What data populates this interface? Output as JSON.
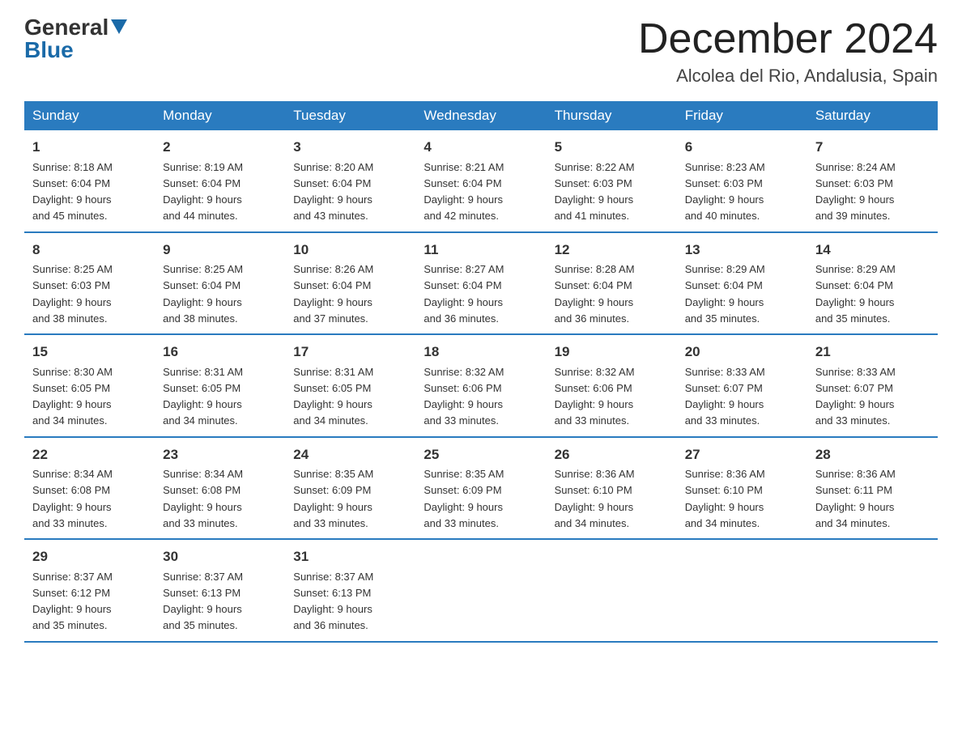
{
  "header": {
    "logo_general": "General",
    "logo_blue": "Blue",
    "month_title": "December 2024",
    "location": "Alcolea del Rio, Andalusia, Spain"
  },
  "days_of_week": [
    "Sunday",
    "Monday",
    "Tuesday",
    "Wednesday",
    "Thursday",
    "Friday",
    "Saturday"
  ],
  "weeks": [
    [
      {
        "day": "1",
        "sunrise": "8:18 AM",
        "sunset": "6:04 PM",
        "daylight": "9 hours and 45 minutes."
      },
      {
        "day": "2",
        "sunrise": "8:19 AM",
        "sunset": "6:04 PM",
        "daylight": "9 hours and 44 minutes."
      },
      {
        "day": "3",
        "sunrise": "8:20 AM",
        "sunset": "6:04 PM",
        "daylight": "9 hours and 43 minutes."
      },
      {
        "day": "4",
        "sunrise": "8:21 AM",
        "sunset": "6:04 PM",
        "daylight": "9 hours and 42 minutes."
      },
      {
        "day": "5",
        "sunrise": "8:22 AM",
        "sunset": "6:03 PM",
        "daylight": "9 hours and 41 minutes."
      },
      {
        "day": "6",
        "sunrise": "8:23 AM",
        "sunset": "6:03 PM",
        "daylight": "9 hours and 40 minutes."
      },
      {
        "day": "7",
        "sunrise": "8:24 AM",
        "sunset": "6:03 PM",
        "daylight": "9 hours and 39 minutes."
      }
    ],
    [
      {
        "day": "8",
        "sunrise": "8:25 AM",
        "sunset": "6:03 PM",
        "daylight": "9 hours and 38 minutes."
      },
      {
        "day": "9",
        "sunrise": "8:25 AM",
        "sunset": "6:04 PM",
        "daylight": "9 hours and 38 minutes."
      },
      {
        "day": "10",
        "sunrise": "8:26 AM",
        "sunset": "6:04 PM",
        "daylight": "9 hours and 37 minutes."
      },
      {
        "day": "11",
        "sunrise": "8:27 AM",
        "sunset": "6:04 PM",
        "daylight": "9 hours and 36 minutes."
      },
      {
        "day": "12",
        "sunrise": "8:28 AM",
        "sunset": "6:04 PM",
        "daylight": "9 hours and 36 minutes."
      },
      {
        "day": "13",
        "sunrise": "8:29 AM",
        "sunset": "6:04 PM",
        "daylight": "9 hours and 35 minutes."
      },
      {
        "day": "14",
        "sunrise": "8:29 AM",
        "sunset": "6:04 PM",
        "daylight": "9 hours and 35 minutes."
      }
    ],
    [
      {
        "day": "15",
        "sunrise": "8:30 AM",
        "sunset": "6:05 PM",
        "daylight": "9 hours and 34 minutes."
      },
      {
        "day": "16",
        "sunrise": "8:31 AM",
        "sunset": "6:05 PM",
        "daylight": "9 hours and 34 minutes."
      },
      {
        "day": "17",
        "sunrise": "8:31 AM",
        "sunset": "6:05 PM",
        "daylight": "9 hours and 34 minutes."
      },
      {
        "day": "18",
        "sunrise": "8:32 AM",
        "sunset": "6:06 PM",
        "daylight": "9 hours and 33 minutes."
      },
      {
        "day": "19",
        "sunrise": "8:32 AM",
        "sunset": "6:06 PM",
        "daylight": "9 hours and 33 minutes."
      },
      {
        "day": "20",
        "sunrise": "8:33 AM",
        "sunset": "6:07 PM",
        "daylight": "9 hours and 33 minutes."
      },
      {
        "day": "21",
        "sunrise": "8:33 AM",
        "sunset": "6:07 PM",
        "daylight": "9 hours and 33 minutes."
      }
    ],
    [
      {
        "day": "22",
        "sunrise": "8:34 AM",
        "sunset": "6:08 PM",
        "daylight": "9 hours and 33 minutes."
      },
      {
        "day": "23",
        "sunrise": "8:34 AM",
        "sunset": "6:08 PM",
        "daylight": "9 hours and 33 minutes."
      },
      {
        "day": "24",
        "sunrise": "8:35 AM",
        "sunset": "6:09 PM",
        "daylight": "9 hours and 33 minutes."
      },
      {
        "day": "25",
        "sunrise": "8:35 AM",
        "sunset": "6:09 PM",
        "daylight": "9 hours and 33 minutes."
      },
      {
        "day": "26",
        "sunrise": "8:36 AM",
        "sunset": "6:10 PM",
        "daylight": "9 hours and 34 minutes."
      },
      {
        "day": "27",
        "sunrise": "8:36 AM",
        "sunset": "6:10 PM",
        "daylight": "9 hours and 34 minutes."
      },
      {
        "day": "28",
        "sunrise": "8:36 AM",
        "sunset": "6:11 PM",
        "daylight": "9 hours and 34 minutes."
      }
    ],
    [
      {
        "day": "29",
        "sunrise": "8:37 AM",
        "sunset": "6:12 PM",
        "daylight": "9 hours and 35 minutes."
      },
      {
        "day": "30",
        "sunrise": "8:37 AM",
        "sunset": "6:13 PM",
        "daylight": "9 hours and 35 minutes."
      },
      {
        "day": "31",
        "sunrise": "8:37 AM",
        "sunset": "6:13 PM",
        "daylight": "9 hours and 36 minutes."
      },
      null,
      null,
      null,
      null
    ]
  ],
  "labels": {
    "sunrise": "Sunrise:",
    "sunset": "Sunset:",
    "daylight": "Daylight:"
  }
}
